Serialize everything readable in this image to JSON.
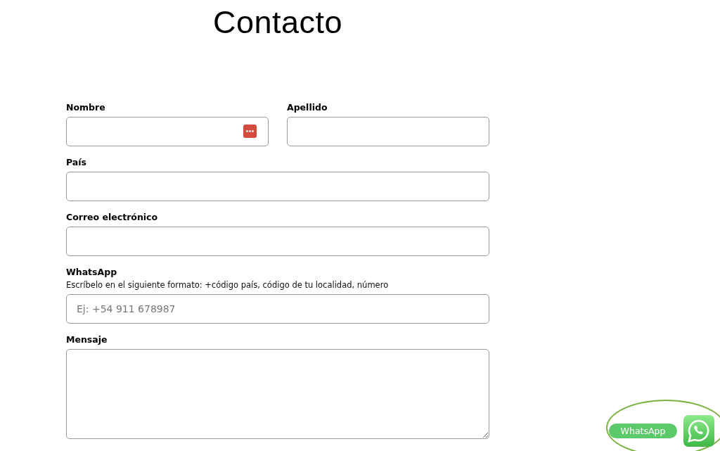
{
  "title": "Contacto",
  "rows": [
    {
      "fields": [
        {
          "label": "Nombre",
          "kind": "input",
          "autofill": true
        },
        {
          "label": "Apellido",
          "kind": "input"
        }
      ]
    },
    {
      "fields": [
        {
          "label": "País",
          "kind": "input"
        }
      ]
    },
    {
      "fields": [
        {
          "label": "Correo electrónico",
          "kind": "input"
        }
      ]
    },
    {
      "fields": [
        {
          "label": "WhatsApp",
          "hint": "Escríbelo en el siguiente formato: +código país, código de tu localidad, número",
          "kind": "input",
          "placeholder": "Ej: +54 911 678987"
        }
      ]
    },
    {
      "fields": [
        {
          "label": "Mensaje",
          "kind": "textarea"
        }
      ]
    }
  ],
  "whatsapp_widget": {
    "label": "WhatsApp"
  }
}
